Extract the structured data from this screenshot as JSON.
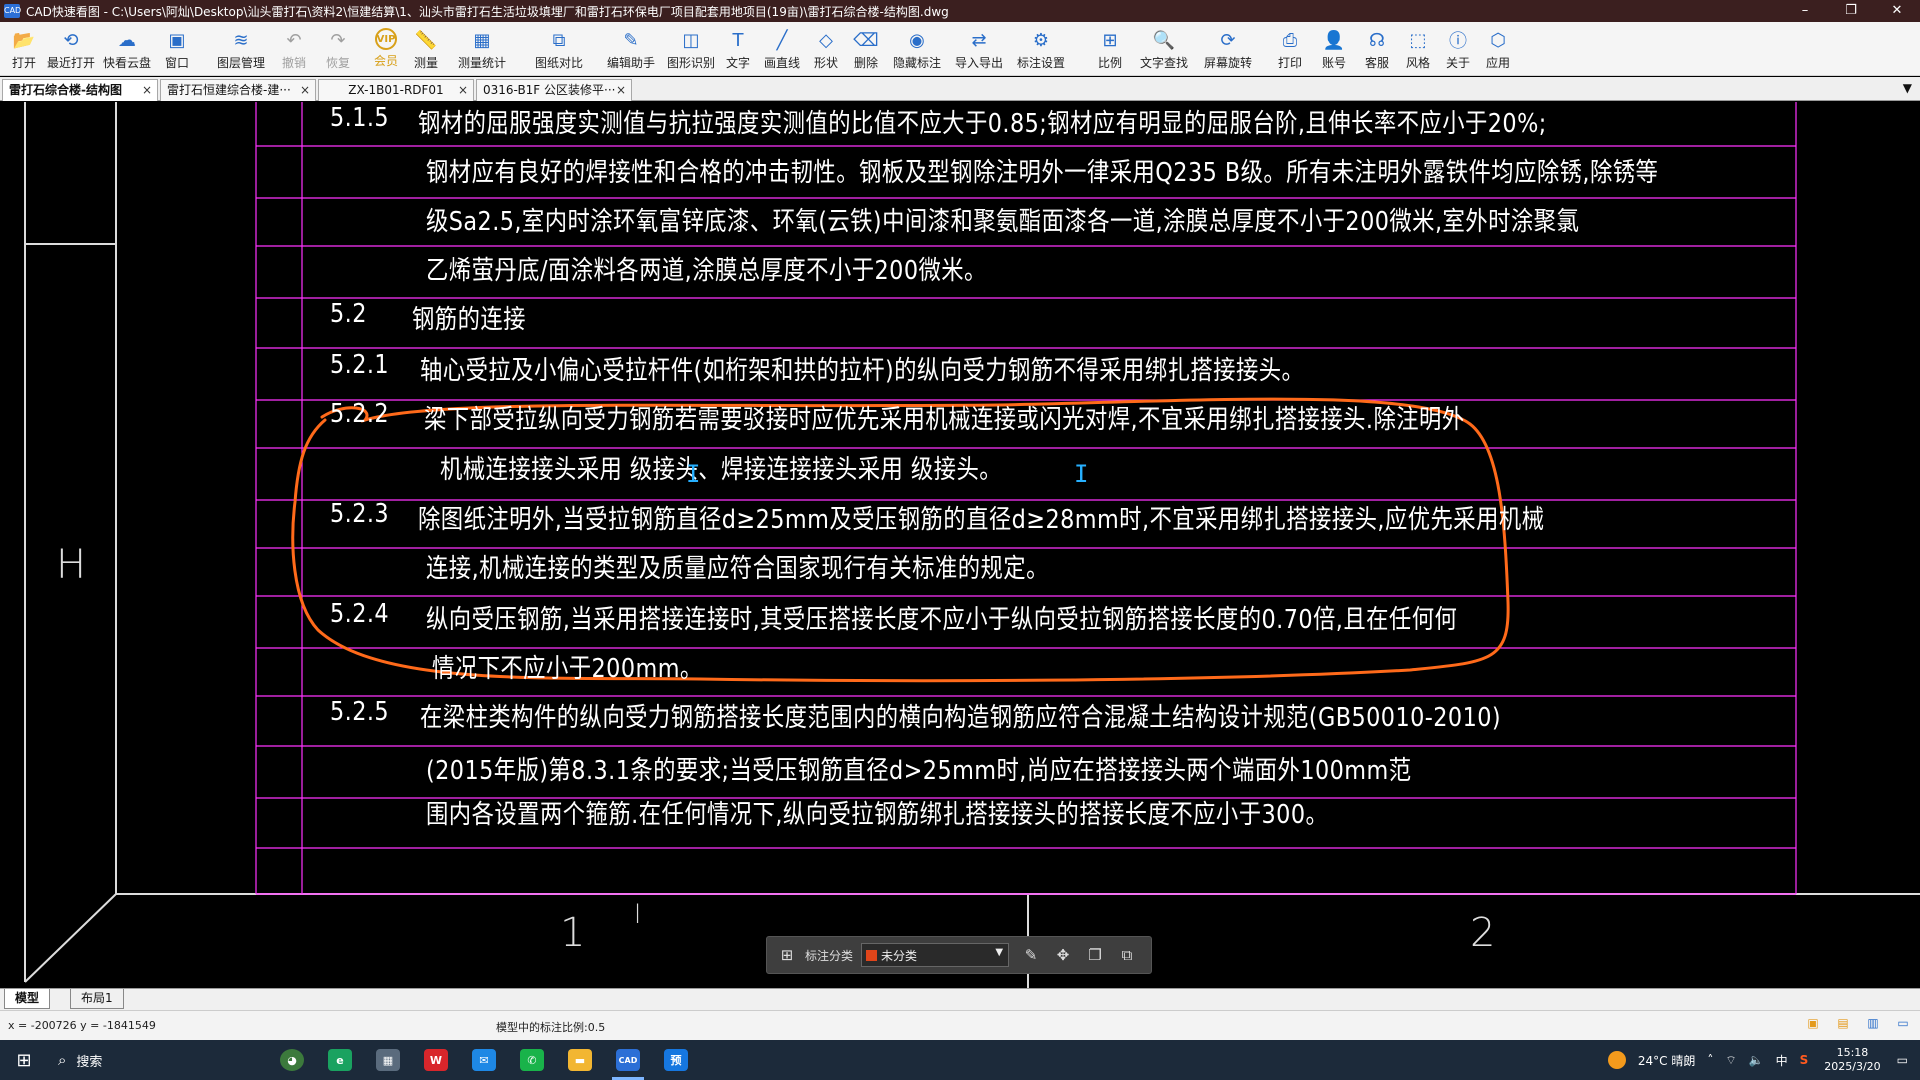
{
  "window": {
    "title": "CAD快速看图 - C:\\Users\\阿灿\\Desktop\\汕头雷打石\\资料2\\恒建结算\\1、汕头市雷打石生活垃圾填埋厂和雷打石环保电厂项目配套用地项目(19亩)\\雷打石综合楼-结构图.dwg",
    "app_icon": "CAD",
    "minimize": "–",
    "maximize": "❐",
    "close": "✕"
  },
  "toolbar": [
    {
      "label": "打开",
      "icon": "folder-icon",
      "glyph": "📂"
    },
    {
      "label": "最近打开",
      "icon": "history-icon",
      "glyph": "⟲"
    },
    {
      "label": "快看云盘",
      "icon": "cloud-icon",
      "glyph": "☁"
    },
    {
      "label": "窗口",
      "icon": "window-icon",
      "glyph": "▣"
    },
    {
      "label": "图层管理",
      "icon": "layers-icon",
      "glyph": "≋"
    },
    {
      "label": "撤销",
      "icon": "undo-icon",
      "glyph": "↶"
    },
    {
      "label": "恢复",
      "icon": "redo-icon",
      "glyph": "↷"
    },
    {
      "label": "会员",
      "icon": "vip-icon",
      "glyph": "VIP"
    },
    {
      "label": "测量",
      "icon": "measure-icon",
      "glyph": "📏"
    },
    {
      "label": "测量统计",
      "icon": "measure-stats-icon",
      "glyph": "▦"
    },
    {
      "label": "图纸对比",
      "icon": "compare-icon",
      "glyph": "⧉"
    },
    {
      "label": "编辑助手",
      "icon": "edit-assistant-icon",
      "glyph": "✎"
    },
    {
      "label": "图形识别",
      "icon": "shape-recognition-icon",
      "glyph": "◫"
    },
    {
      "label": "文字",
      "icon": "text-icon",
      "glyph": "T"
    },
    {
      "label": "画直线",
      "icon": "line-icon",
      "glyph": "╱"
    },
    {
      "label": "形状",
      "icon": "shape-icon",
      "glyph": "◇"
    },
    {
      "label": "删除",
      "icon": "eraser-icon",
      "glyph": "⌫"
    },
    {
      "label": "隐藏标注",
      "icon": "hide-annotation-icon",
      "glyph": "◉"
    },
    {
      "label": "导入导出",
      "icon": "import-export-icon",
      "glyph": "⇄"
    },
    {
      "label": "标注设置",
      "icon": "annotation-settings-icon",
      "glyph": "⚙"
    },
    {
      "label": "比例",
      "icon": "scale-icon",
      "glyph": "⊞"
    },
    {
      "label": "文字查找",
      "icon": "text-search-icon",
      "glyph": "🔍"
    },
    {
      "label": "屏幕旋转",
      "icon": "rotate-icon",
      "glyph": "⟳"
    },
    {
      "label": "打印",
      "icon": "print-icon",
      "glyph": "⎙"
    },
    {
      "label": "账号",
      "icon": "account-icon",
      "glyph": "👤"
    },
    {
      "label": "客服",
      "icon": "headset-icon",
      "glyph": "☊"
    },
    {
      "label": "风格",
      "icon": "style-icon",
      "glyph": "⬚"
    },
    {
      "label": "关于",
      "icon": "info-icon",
      "glyph": "ⓘ"
    },
    {
      "label": "应用",
      "icon": "apps-icon",
      "glyph": "⬡"
    }
  ],
  "tabs": [
    {
      "label": "雷打石综合楼-结构图",
      "close": "×"
    },
    {
      "label": "雷打石恒建综合楼-建···",
      "close": "×"
    },
    {
      "label": "ZX-1B01-RDF01",
      "close": "×"
    },
    {
      "label": "0316-B1F 公区装修平···",
      "close": "×"
    }
  ],
  "tab_menu": "▼",
  "drawing": {
    "lines": [
      {
        "num": "5.1.5",
        "text": "钢材的屈服强度实测值与抗拉强度实测值的比值不应大于0.85;钢材应有明显的屈服台阶,且伸长率不应小于20%;"
      },
      {
        "num": "",
        "text": "钢材应有良好的焊接性和合格的冲击韧性。钢板及型钢除注明外一律采用Q235 B级。所有未注明外露铁件均应除锈,除锈等"
      },
      {
        "num": "",
        "text": "级Sa2.5,室内时涂环氧富锌底漆、环氧(云铁)中间漆和聚氨酯面漆各一道,涂膜总厚度不小于200微米,室外时涂聚氯"
      },
      {
        "num": "",
        "text": "乙烯萤丹底/面涂料各两道,涂膜总厚度不小于200微米。"
      },
      {
        "num": "5.2",
        "text": "钢筋的连接"
      },
      {
        "num": "5.2.1",
        "text": "轴心受拉及小偏心受拉杆件(如桁架和拱的拉杆)的纵向受力钢筋不得采用绑扎搭接接头。"
      },
      {
        "num": "5.2.2",
        "text": "梁下部受拉纵向受力钢筋若需要驳接时应优先采用机械连接或闪光对焊,不宜采用绑扎搭接接头.除注明外"
      },
      {
        "num": "",
        "text": "机械连接接头采用     级接头、焊接连接接头采用     级接头。"
      },
      {
        "num": "5.2.3",
        "text": "除图纸注明外,当受拉钢筋直径d≥25mm及受压钢筋的直径d≥28mm时,不宜采用绑扎搭接接头,应优先采用机械"
      },
      {
        "num": "",
        "text": "连接,机械连接的类型及质量应符合国家现行有关标准的规定。"
      },
      {
        "num": "5.2.4",
        "text": "纵向受压钢筋,当采用搭接连接时,其受压搭接长度不应小于纵向受拉钢筋搭接长度的0.70倍,且在任何何"
      },
      {
        "num": "",
        "text": "情况下不应小于200mm。"
      },
      {
        "num": "5.2.5",
        "text": "在梁柱类构件的纵向受力钢筋搭接长度范围内的横向构造钢筋应符合混凝土结构设计规范(GB50010-2010)"
      },
      {
        "num": "",
        "text": "(2015年版)第8.3.1条的要求;当受压钢筋直径d>25mm时,尚应在搭接接头两个端面外100mm范"
      },
      {
        "num": "",
        "text": "围内各设置两个箍筋.在任何情况下,纵向受拉钢筋绑扎搭接接头的搭接长度不应小于300。"
      }
    ],
    "row_label": "H",
    "col_labels": [
      "1",
      "2"
    ],
    "small_mark": "l",
    "text_cursor": "I",
    "colors": {
      "background": "#000000",
      "grid": "#ff33ff",
      "text": "#ffffff",
      "markup": "#ff6a1a",
      "frame": "#dcdcdc"
    }
  },
  "annotation_bar": {
    "label": "标注分类",
    "value": "未分类",
    "swatch_color": "#e0451a",
    "dropdown": "▼",
    "grid_icon": "⊞",
    "actions": [
      "✎",
      "✥",
      "❐",
      "⧉"
    ]
  },
  "layout_tabs": [
    "模型",
    "布局1"
  ],
  "status": {
    "coords": "x = -200726  y = -1841549",
    "scale": "模型中的标注比例:0.5"
  },
  "taskbar": {
    "search": "搜索",
    "apps": [
      {
        "icon": "edge-icon",
        "glyph": "e",
        "color": "#1aa260"
      },
      {
        "icon": "calculator-icon",
        "glyph": "▦",
        "color": "#5a6b7d"
      },
      {
        "icon": "wps-icon",
        "glyph": "W",
        "color": "#d8262b"
      },
      {
        "icon": "bird-app-icon",
        "glyph": "✉",
        "color": "#1e88e5"
      },
      {
        "icon": "wechat-icon",
        "glyph": "✆",
        "color": "#19b34a"
      },
      {
        "icon": "file-explorer-icon",
        "glyph": "▬",
        "color": "#f2b632"
      },
      {
        "icon": "cad-app-icon",
        "glyph": "CAD",
        "color": "#2c6fd6"
      },
      {
        "icon": "preview-app-icon",
        "glyph": "预",
        "color": "#1677e0"
      }
    ],
    "weather": "24°C  晴朗",
    "ime": "中",
    "time": "15:18",
    "date": "2025/3/20"
  }
}
